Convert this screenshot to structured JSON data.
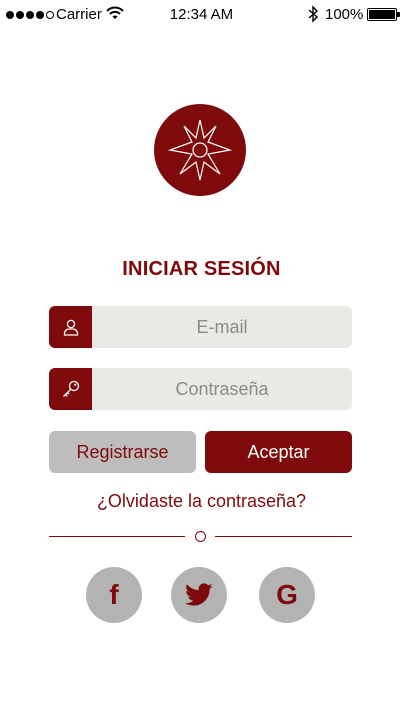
{
  "status_bar": {
    "carrier": "Carrier",
    "time": "12:34 AM",
    "battery_percent": "100%",
    "signal_bars_filled": 4,
    "signal_bars_total": 5
  },
  "login": {
    "title": "INICIAR SESIÓN",
    "email_placeholder": "E-mail",
    "password_placeholder": "Contraseña",
    "register_label": "Registrarse",
    "accept_label": "Aceptar",
    "forgot_label": "¿Olvidaste la contraseña?"
  },
  "social": {
    "facebook_glyph": "f",
    "google_glyph": "G"
  },
  "colors": {
    "brand": "#7f0a0c",
    "field_bg": "#ebe9e5",
    "secondary_button": "#bdbdbd",
    "social_bg": "#b3b3b3"
  },
  "icons": [
    "wifi-icon",
    "bluetooth-icon",
    "battery-icon",
    "compass-star-logo",
    "user-icon",
    "key-icon",
    "facebook-icon",
    "twitter-icon",
    "google-icon"
  ]
}
